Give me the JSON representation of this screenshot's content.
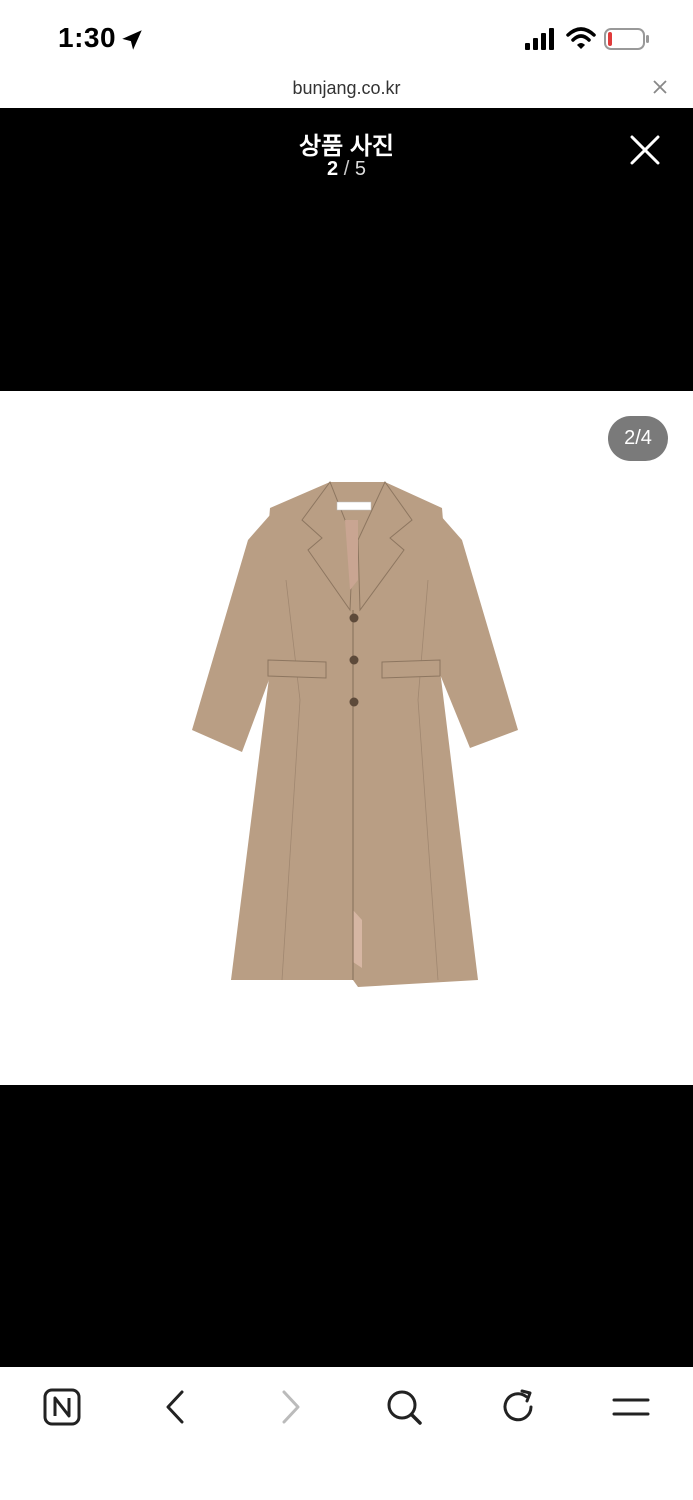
{
  "status_bar": {
    "time": "1:30",
    "icons": [
      "location-arrow-icon",
      "cellular-signal-icon",
      "wifi-icon",
      "battery-low-icon"
    ],
    "battery_color": "#e03b3b"
  },
  "browser": {
    "url": "bunjang.co.kr"
  },
  "viewer": {
    "title": "상품 사진",
    "counter_current": "2",
    "counter_separator": " / ",
    "counter_total": "5",
    "image_badge": "2/4",
    "image_subject": "beige long tailored coat",
    "coat_color": "#b99e84"
  },
  "toolbar": {
    "buttons": [
      "naver-home-icon",
      "back-icon",
      "forward-icon",
      "search-icon",
      "reload-icon",
      "menu-icon"
    ]
  },
  "colors": {
    "viewer_background": "#000000",
    "badge_background": "#7a7a7a"
  }
}
